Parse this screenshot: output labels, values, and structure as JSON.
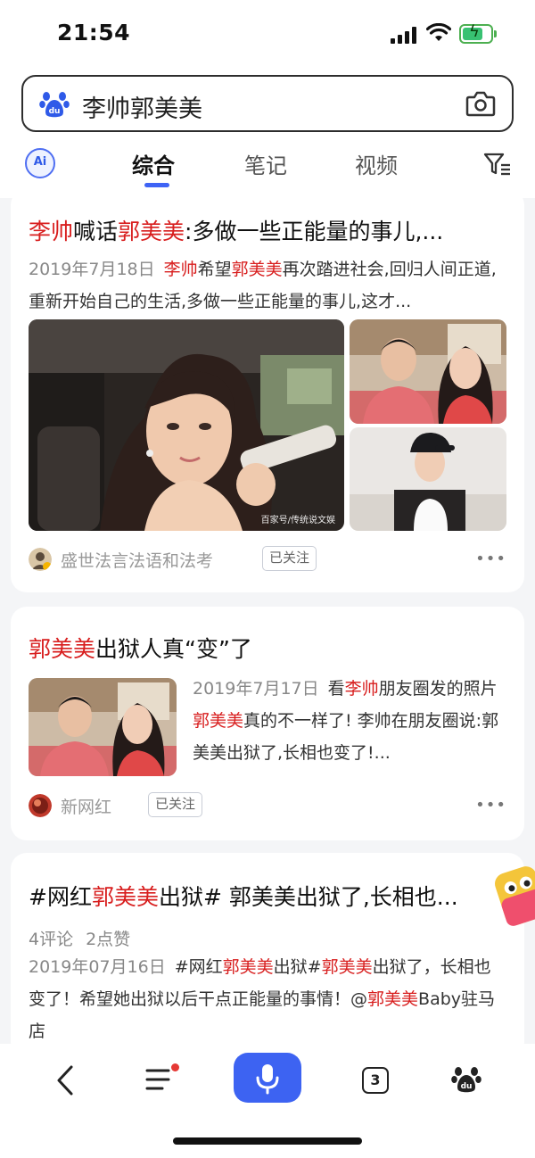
{
  "status_bar": {
    "time": "21:54"
  },
  "search": {
    "query": "李帅郭美美",
    "logo_icon": "baidu-paw-icon",
    "camera_icon": "camera-icon"
  },
  "tabs": {
    "ai_label": "Ai",
    "items": [
      {
        "label": "综合",
        "active": true
      },
      {
        "label": "笔记",
        "active": false
      },
      {
        "label": "视频",
        "active": false
      }
    ],
    "filter_icon": "filter-icon"
  },
  "results": [
    {
      "title": [
        {
          "text": "李帅",
          "hl": true
        },
        {
          "text": "喊话",
          "hl": false
        },
        {
          "text": "郭美美",
          "hl": true
        },
        {
          "text": ":多做一些正能量的事儿,...",
          "hl": false
        }
      ],
      "date": "2019年7月18日",
      "snippet": [
        {
          "text": "李帅",
          "hl": true
        },
        {
          "text": "希望",
          "hl": false
        },
        {
          "text": "郭美美",
          "hl": true
        },
        {
          "text": "再次踏进社会,回归人间正道,重新开始自己的生活,多做一些正能量的事儿,这才...",
          "hl": false
        }
      ],
      "image_watermark": "百家号/传统说文娱",
      "source": "盛世法言法语和法考",
      "follow_label": "已关注",
      "more_label": "•••"
    },
    {
      "title": [
        {
          "text": "郭美美",
          "hl": true
        },
        {
          "text": "出狱人真“变”了",
          "hl": false
        }
      ],
      "date": "2019年7月17日",
      "snippet": [
        {
          "text": "看",
          "hl": false
        },
        {
          "text": "李帅",
          "hl": true
        },
        {
          "text": "朋友圈发的照片",
          "hl": false
        },
        {
          "text": "郭美美",
          "hl": true
        },
        {
          "text": "真的不一样了! 李帅在朋友圈说:郭美美出狱了,长相也变了!...",
          "hl": false
        }
      ],
      "source": "新网红",
      "follow_label": "已关注",
      "more_label": "•••"
    },
    {
      "title": [
        {
          "text": "#网红",
          "hl": false
        },
        {
          "text": "郭美美",
          "hl": true
        },
        {
          "text": "出狱# 郭美美出狱了,长相也...",
          "hl": false
        }
      ],
      "comments": "4评论",
      "likes": "2点赞",
      "date": "2019年07月16日",
      "snippet": [
        {
          "text": "#网红",
          "hl": false
        },
        {
          "text": "郭美美",
          "hl": true
        },
        {
          "text": "出狱#",
          "hl": false
        },
        {
          "text": "郭美美",
          "hl": true
        },
        {
          "text": "出狱了，长相也变了！希望她出狱以后干点正能量的事情！@",
          "hl": false
        },
        {
          "text": "郭美美",
          "hl": true
        },
        {
          "text": "Baby驻马店",
          "hl": false
        }
      ]
    }
  ],
  "bottom_bar": {
    "back_icon": "chevron-left-icon",
    "menu_icon": "menu-icon",
    "voice_icon": "microphone-icon",
    "tab_count": "3",
    "home_icon": "baidu-paw-icon"
  }
}
